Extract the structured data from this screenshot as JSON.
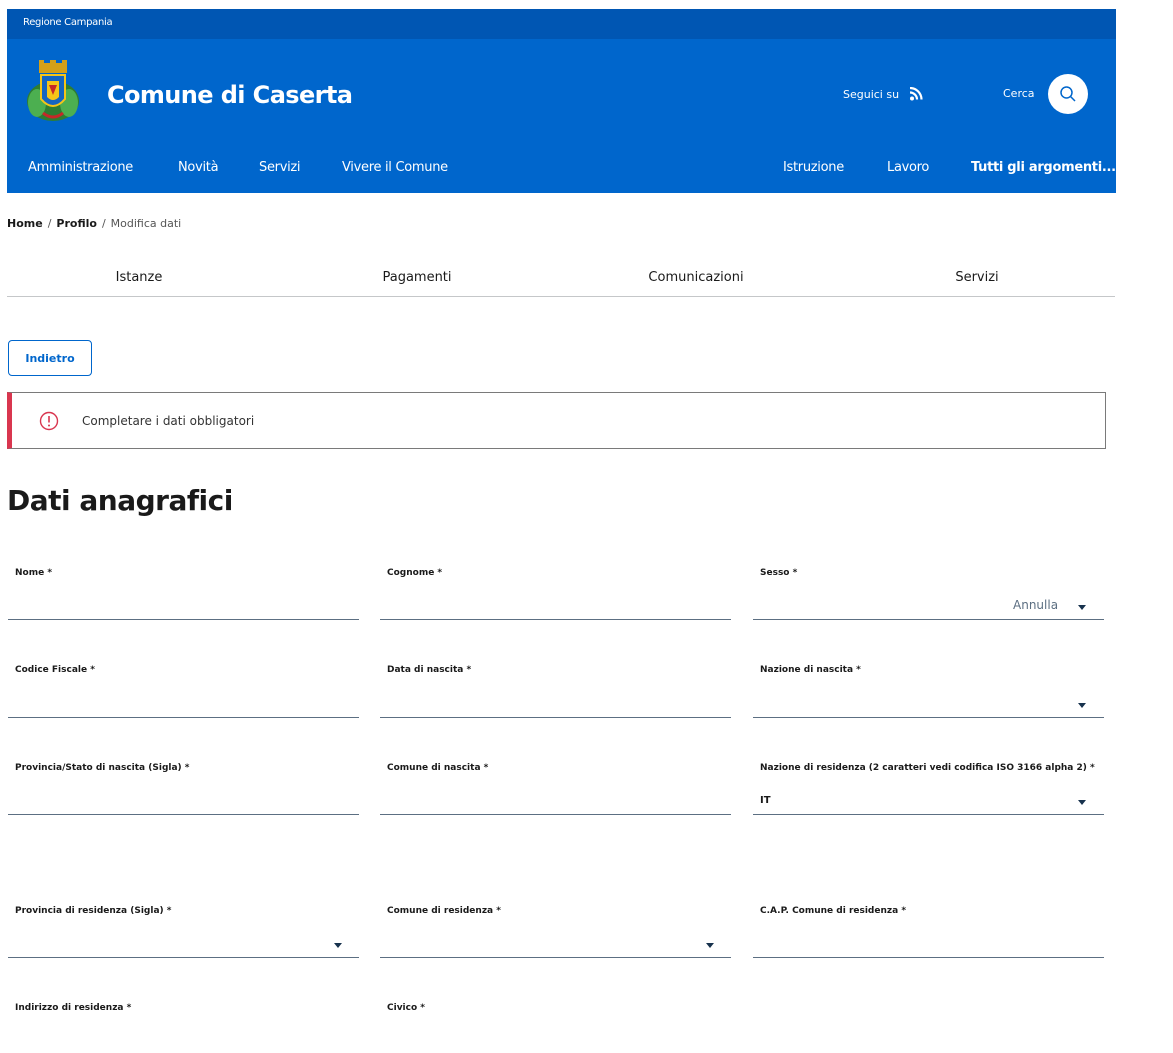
{
  "top_bar": {
    "region": "Regione Campania"
  },
  "header": {
    "title": "Comune di Caserta",
    "social_label": "Seguici su",
    "search_label": "Cerca"
  },
  "nav": {
    "left": [
      "Amministrazione",
      "Novità",
      "Servizi",
      "Vivere il Comune"
    ],
    "right": [
      "Istruzione",
      "Lavoro"
    ],
    "all_topics": "Tutti gli argomenti..."
  },
  "breadcrumb": {
    "home": "Home",
    "profile": "Profilo",
    "current": "Modifica dati",
    "separator": "/"
  },
  "tabs": [
    "Istanze",
    "Pagamenti",
    "Comunicazioni",
    "Servizi"
  ],
  "back_button": "Indietro",
  "alert": {
    "text": "Completare i dati obbligatori"
  },
  "section_title": "Dati anagrafici",
  "form": {
    "nome": {
      "label": "Nome *",
      "value": ""
    },
    "cognome": {
      "label": "Cognome *",
      "value": ""
    },
    "sesso": {
      "label": "Sesso *",
      "value": "Annulla"
    },
    "codice_fiscale": {
      "label": "Codice Fiscale *",
      "value": ""
    },
    "data_nascita": {
      "label": "Data di nascita *",
      "value": ""
    },
    "nazione_nascita": {
      "label": "Nazione di nascita *",
      "value": ""
    },
    "provincia_nascita": {
      "label": "Provincia/Stato di nascita (Sigla) *",
      "value": ""
    },
    "comune_nascita": {
      "label": "Comune di nascita *",
      "value": ""
    },
    "nazione_residenza": {
      "label": "Nazione di residenza (2 caratteri vedi codifica ISO 3166 alpha 2) *",
      "value": "IT"
    },
    "provincia_residenza": {
      "label": "Provincia di residenza (Sigla) *",
      "value": ""
    },
    "comune_residenza": {
      "label": "Comune di residenza *",
      "value": ""
    },
    "cap_residenza": {
      "label": "C.A.P. Comune di residenza *",
      "value": ""
    },
    "indirizzo_residenza": {
      "label": "Indirizzo di residenza *",
      "value": ""
    },
    "civico": {
      "label": "Civico *",
      "value": ""
    }
  },
  "colors": {
    "primary": "#0066cc",
    "slim_header": "#0056b3",
    "alert_danger": "#d9364f",
    "field_line": "#5c6f82"
  },
  "icons": {
    "rss": "rss-icon",
    "search": "search-icon",
    "alert": "exclamation-circle-icon",
    "select": "caret-down-icon",
    "logo": "coat-of-arms-logo"
  }
}
